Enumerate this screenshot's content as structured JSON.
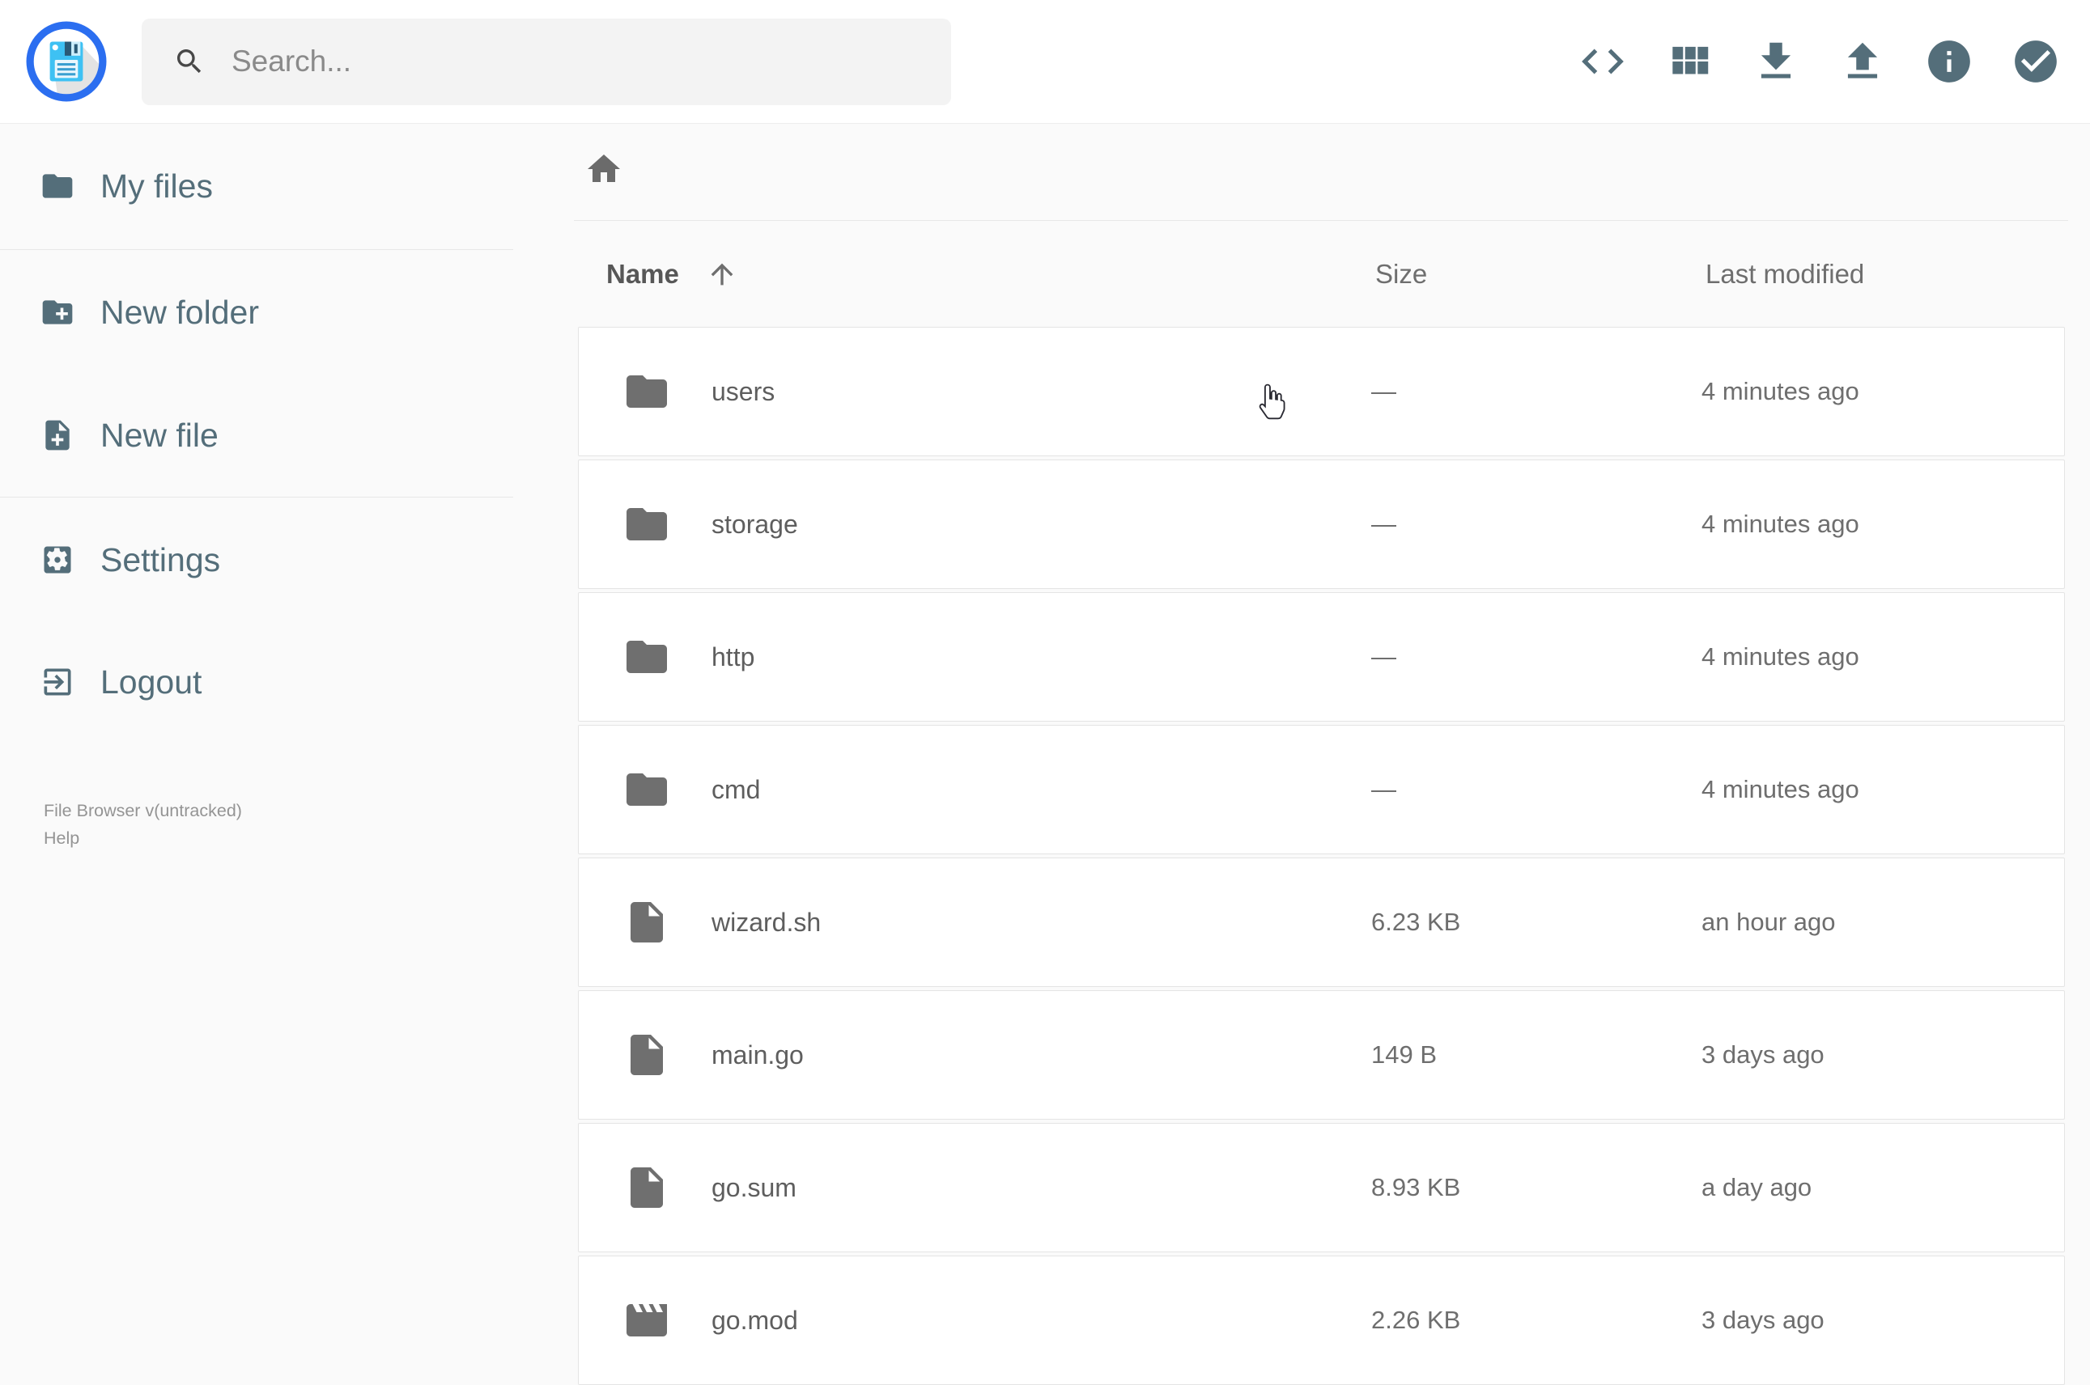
{
  "topbar": {
    "search": {
      "placeholder": "Search..."
    },
    "actions": {
      "raw_view": "raw-view",
      "switch_view": "switch-view",
      "download": "download",
      "upload": "upload",
      "info": "info",
      "select_multiple": "select-multiple"
    }
  },
  "sidebar": {
    "items": [
      {
        "label": "My files",
        "icon": "folder-icon"
      },
      {
        "label": "New folder",
        "icon": "folder-plus-icon"
      },
      {
        "label": "New file",
        "icon": "file-plus-icon"
      },
      {
        "label": "Settings",
        "icon": "settings-icon"
      },
      {
        "label": "Logout",
        "icon": "logout-icon"
      }
    ],
    "version": "File Browser v(untracked)",
    "help": "Help"
  },
  "listing": {
    "columns": {
      "name": "Name",
      "size": "Size",
      "modified": "Last modified"
    },
    "sort": {
      "column": "Name",
      "direction": "ascending"
    },
    "rows": [
      {
        "name": "users",
        "icon": "folder-icon",
        "size": "—",
        "modified": "4 minutes ago"
      },
      {
        "name": "storage",
        "icon": "folder-icon",
        "size": "—",
        "modified": "4 minutes ago"
      },
      {
        "name": "http",
        "icon": "folder-icon",
        "size": "—",
        "modified": "4 minutes ago"
      },
      {
        "name": "cmd",
        "icon": "folder-icon",
        "size": "—",
        "modified": "4 minutes ago"
      },
      {
        "name": "wizard.sh",
        "icon": "file-icon",
        "size": "6.23 KB",
        "modified": "an hour ago"
      },
      {
        "name": "main.go",
        "icon": "file-icon",
        "size": "149 B",
        "modified": "3 days ago"
      },
      {
        "name": "go.sum",
        "icon": "file-icon",
        "size": "8.93 KB",
        "modified": "a day ago"
      },
      {
        "name": "go.mod",
        "icon": "movie-icon",
        "size": "2.26 KB",
        "modified": "3 days ago"
      }
    ]
  },
  "colors": {
    "accent_ring_blue": "#2b6ef0",
    "floppy_blue": "#3ec1f3",
    "slate_icon": "#546e7a",
    "row_text_gray": "#5e5e5e",
    "muted_gray": "#6e6e6e",
    "page_bg": "#fafafa",
    "card_border": "#e4e4e4"
  }
}
